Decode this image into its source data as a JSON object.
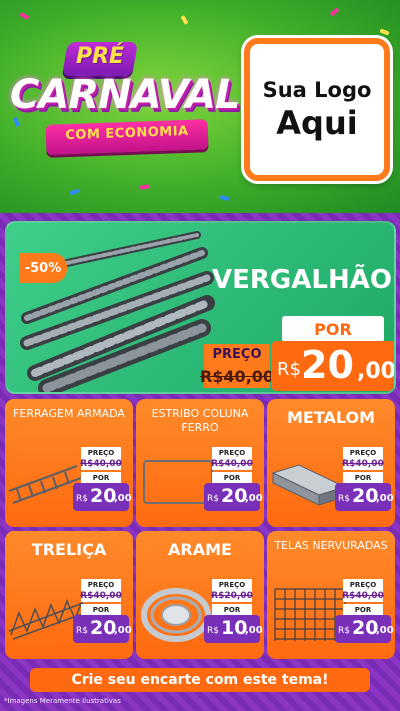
{
  "brand": {
    "pre": "PRÉ",
    "main": "CARNAVAL",
    "sub": "COM ECONOMIA"
  },
  "logo": {
    "line1": "Sua Logo",
    "line2": "Aqui"
  },
  "hero": {
    "discount": "-50%",
    "title": "VERGALHÃO",
    "old_label": "PREÇO",
    "old_price": "R$40,00",
    "new_label": "POR",
    "currency": "R$",
    "new_int": "20",
    "new_dec": ",00"
  },
  "products": [
    {
      "name": "FERRAGEM ARMADA",
      "label_preco": "PREÇO",
      "old": "R$40,00",
      "label_por": "POR",
      "currency": "R$",
      "int": "20",
      "dec": ",00"
    },
    {
      "name": "ESTRIBO COLUNA FERRO",
      "label_preco": "PREÇO",
      "old": "R$40,00",
      "label_por": "POR",
      "currency": "R$",
      "int": "20",
      "dec": ",00"
    },
    {
      "name": "METALOM",
      "label_preco": "PREÇO",
      "old": "R$40,00",
      "label_por": "POR",
      "currency": "R$",
      "int": "20",
      "dec": ",00"
    },
    {
      "name": "TRELIÇA",
      "label_preco": "PREÇO",
      "old": "R$40,00",
      "label_por": "POR",
      "currency": "R$",
      "int": "20",
      "dec": ",00"
    },
    {
      "name": "ARAME",
      "label_preco": "PREÇO",
      "old": "R$20,00",
      "label_por": "POR",
      "currency": "R$",
      "int": "10",
      "dec": ",00"
    },
    {
      "name": "TELAS NERVURADAS",
      "label_preco": "PREÇO",
      "old": "R$40,00",
      "label_por": "POR",
      "currency": "R$",
      "int": "20",
      "dec": ",00"
    }
  ],
  "cta": "Crie seu encarte com este tema!",
  "disclaimer": "*Imagens Meramente Ilustrativas",
  "colors": {
    "orange": "#ff6a10",
    "purple": "#7a2fb8",
    "green": "#2fbf76"
  }
}
